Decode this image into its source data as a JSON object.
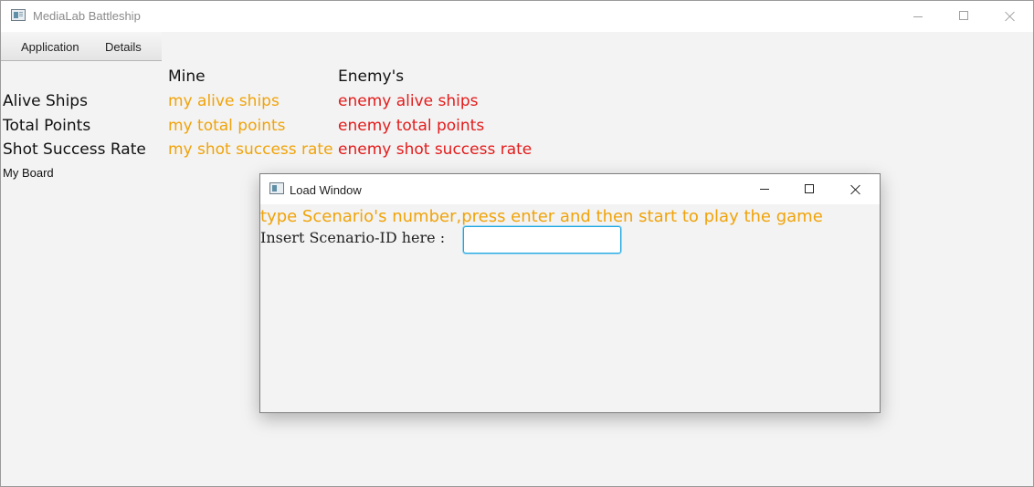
{
  "window": {
    "title": "MediaLab Battleship",
    "icon": "app-window-icon"
  },
  "menu": {
    "items": [
      "Application",
      "Details"
    ]
  },
  "stats": {
    "headers": {
      "mine": "Mine",
      "enemy": "Enemy's"
    },
    "rows": [
      {
        "label": "Alive Ships",
        "mine": "my alive ships",
        "enemy": "enemy alive ships"
      },
      {
        "label": "Total Points",
        "mine": "my total points",
        "enemy": "enemy total points"
      },
      {
        "label": "Shot Success Rate",
        "mine": "my shot success rate",
        "enemy": "enemy shot success rate"
      }
    ]
  },
  "board": {
    "label": "My Board"
  },
  "dialog": {
    "title": "Load Window",
    "instruction": "type Scenario's number,press enter and then start to play the game",
    "insert_label": "Insert Scenario-ID here :",
    "input_value": ""
  },
  "colors": {
    "mine": "#f0a30a",
    "enemy": "#e31b1b",
    "input_focus": "#1ea7e1"
  }
}
